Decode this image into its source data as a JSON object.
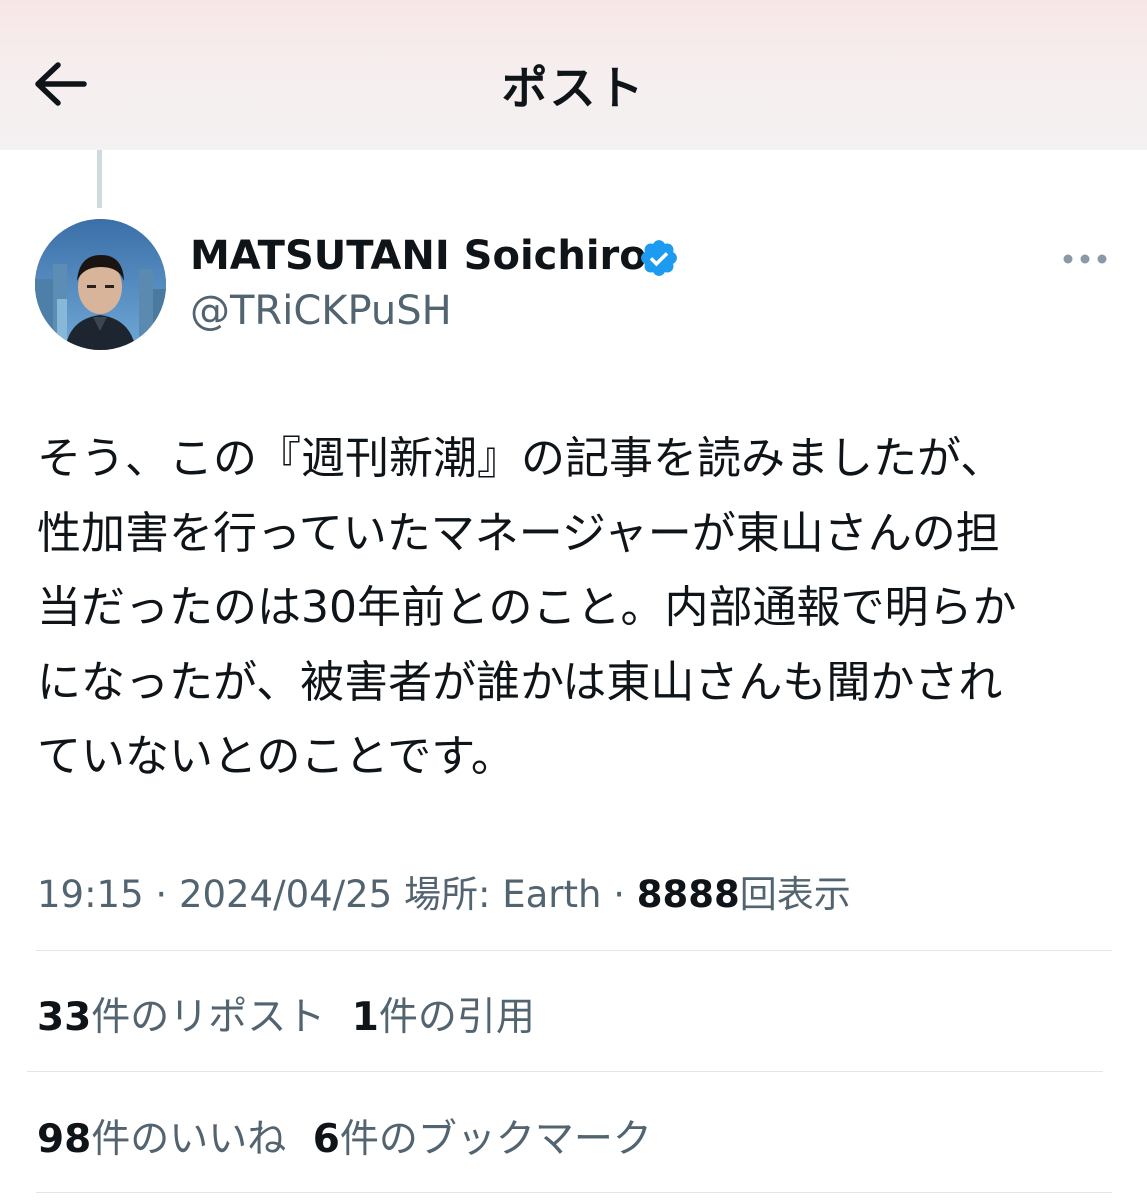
{
  "header": {
    "title": "ポスト"
  },
  "author": {
    "display_name": "MATSUTANI Soichiro",
    "handle": "@TRiCKPuSH",
    "verified": true
  },
  "tweet": {
    "lines": [
      "そう、この『週刊新潮』の記事を読みましたが、",
      "性加害を行っていたマネージャーが東山さんの担",
      "当だったのは30年前とのこと。内部通報で明らか",
      "になったが、被害者が誰かは東山さんも聞かされ",
      "ていないとのことです。"
    ]
  },
  "meta": {
    "time": "19:15",
    "separator": "·",
    "date": "2024/04/25",
    "location_label": "場所: Earth",
    "views_count": "8888",
    "views_label": "回表示"
  },
  "stats": {
    "reposts_count": "33",
    "reposts_label": "件のリポスト",
    "quotes_count": "1",
    "quotes_label": "件の引用",
    "likes_count": "98",
    "likes_label": "件のいいね",
    "bookmarks_count": "6",
    "bookmarks_label": "件のブックマーク"
  },
  "colors": {
    "text_primary": "#0f1419",
    "text_secondary": "#536471",
    "verified_blue": "#1d9bf0",
    "divider": "#e1e6ea"
  }
}
